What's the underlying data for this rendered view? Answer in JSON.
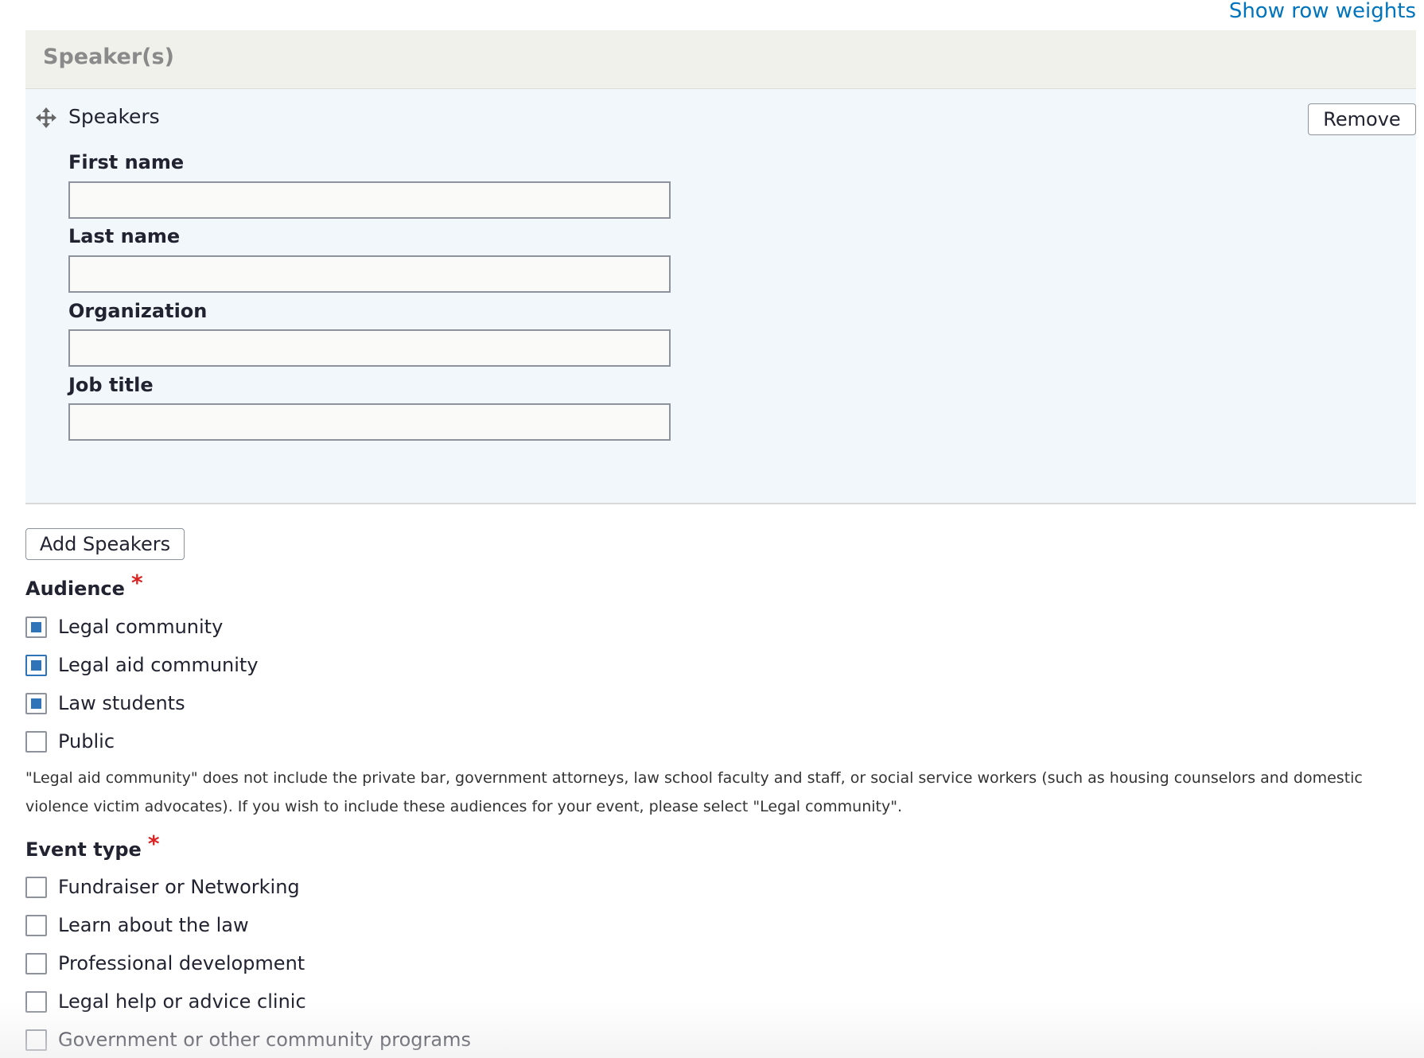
{
  "top_link": "Show row weights",
  "table": {
    "header": "Speaker(s)",
    "row": {
      "label": "Speakers",
      "remove_label": "Remove",
      "fields": {
        "first_name": "First name",
        "last_name": "Last name",
        "organization": "Organization",
        "job_title": "Job title"
      }
    },
    "add_label": "Add Speakers"
  },
  "audience": {
    "label": "Audience",
    "required_marker": "*",
    "options": [
      {
        "label": "Legal community",
        "checked": true
      },
      {
        "label": "Legal aid community",
        "checked": true
      },
      {
        "label": "Law students",
        "checked": true
      },
      {
        "label": "Public",
        "checked": false
      }
    ],
    "description": "\"Legal aid community\" does not include the private bar, government attorneys, law school faculty and staff, or social service workers (such as housing counselors and domestic violence victim advocates). If you wish to include these audiences for your event, please select \"Legal community\"."
  },
  "event_type": {
    "label": "Event type",
    "required_marker": "*",
    "options": [
      {
        "label": "Fundraiser or Networking",
        "checked": false
      },
      {
        "label": "Learn about the law",
        "checked": false
      },
      {
        "label": "Professional development",
        "checked": false
      },
      {
        "label": "Legal help or advice clinic",
        "checked": false
      },
      {
        "label": "Government or other community programs",
        "checked": false
      }
    ]
  },
  "colors": {
    "link": "#0074bd",
    "checkbox_fill": "#2f73b8",
    "required": "#dc2323"
  }
}
